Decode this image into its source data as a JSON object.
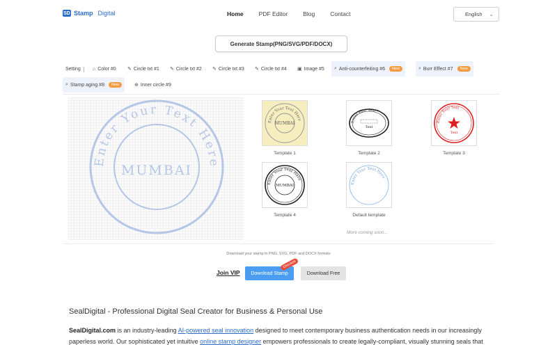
{
  "header": {
    "logo_mark": "SD",
    "logo_stamp": "Stamp",
    "logo_digital": "Digital",
    "nav": [
      "Home",
      "PDF Editor",
      "Blog",
      "Contact"
    ],
    "language": "English"
  },
  "generate_label": "Generate Stamp(PNG/SVG/PDF/DOCX)",
  "tabs": {
    "setting": "Setting",
    "items": [
      {
        "label": "Color #0"
      },
      {
        "label": "Circle txt #1"
      },
      {
        "label": "Circle txt #2"
      },
      {
        "label": "Circle txt #3"
      },
      {
        "label": "Circle txt #4"
      },
      {
        "label": "Image #5"
      },
      {
        "label": "Anti-counterfeiting #6",
        "badge": "New"
      },
      {
        "label": "Burr Effect #7",
        "badge": "New"
      },
      {
        "label": "Stamp aging #8",
        "badge": "New"
      },
      {
        "label": "Inner circle #9"
      }
    ]
  },
  "preview": {
    "ring_text": "Enter Your Text Here",
    "center_text": "MUMBAI",
    "color": "#b5c6e6"
  },
  "templates": [
    {
      "label": "Template 1",
      "ring_text": "Enter Your Text Here",
      "center_text": "MUMBAI"
    },
    {
      "label": "Template 2",
      "ring_text": "Enter Your Text",
      "center_text": "Text"
    },
    {
      "label": "Template 3",
      "ring_text": "Enter Your Text",
      "center_text": "Text"
    },
    {
      "label": "Template 4",
      "ring_text": "Enter Your Text Here",
      "center_text": "MUMBAI"
    },
    {
      "label": "Default template",
      "ring_text": "Enter Your Text Here",
      "center_text": ""
    }
  ],
  "more_coming": "More coming soon...",
  "download": {
    "info": "Download your stamp in PNG, SVG, PDF and DOCX formats",
    "join_vip": "Join VIP",
    "download_stamp": "Download Stamp",
    "discount": "Discount",
    "download_free": "Download Free"
  },
  "article": {
    "heading": "SealDigital - Professional Digital Seal Creator for Business & Personal Use",
    "p1_brand": "SealDigital.com",
    "p1_a": " is an industry-leading ",
    "p1_link1": "AI-powered seal innovation",
    "p1_b": " designed to meet contemporary business authentication needs in our increasingly paperless world. Our sophisticated yet intuitive ",
    "p1_link2": "online stamp designer",
    "p1_c": " empowers professionals to create legally-compliant, visually stunning seals that"
  },
  "colors": {
    "brand": "#2c6cc7",
    "accent_blue": "#4a9df0",
    "badge_orange": "#f39c41",
    "stamp_red": "#e02020"
  }
}
